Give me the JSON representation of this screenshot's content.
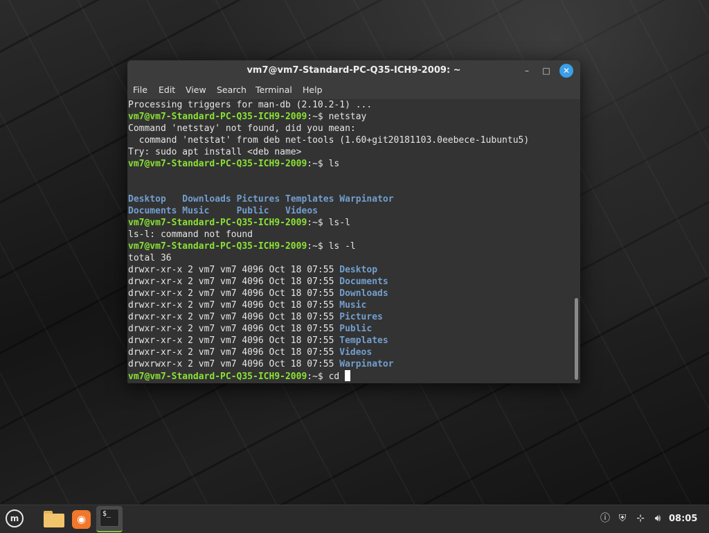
{
  "window": {
    "title": "vm7@vm7-Standard-PC-Q35-ICH9-2009: ~",
    "buttons": {
      "minimize": "–",
      "maximize": "□",
      "close": "✕"
    }
  },
  "menu": [
    "File",
    "Edit",
    "View",
    "Search",
    "Terminal",
    "Help"
  ],
  "terminal": {
    "prompt": "vm7@vm7-Standard-PC-Q35-ICH9-2009",
    "prompt_suffix": ":~$ ",
    "lines": [
      {
        "type": "output",
        "text": "Processing triggers for man-db (2.10.2-1) ..."
      },
      {
        "type": "prompt",
        "cmd": "netstay"
      },
      {
        "type": "output",
        "text": "Command 'netstay' not found, did you mean:"
      },
      {
        "type": "output",
        "text": "  command 'netstat' from deb net-tools (1.60+git20181103.0eebece-1ubuntu5)"
      },
      {
        "type": "output",
        "text": "Try: sudo apt install <deb name>"
      },
      {
        "type": "prompt",
        "cmd": "ls"
      },
      {
        "type": "output",
        "text": ""
      },
      {
        "type": "output",
        "text": ""
      },
      {
        "type": "ls",
        "items": [
          "Desktop   ",
          "Downloads ",
          "Pictures ",
          "Templates ",
          "Warpinator"
        ]
      },
      {
        "type": "ls",
        "items": [
          "Documents ",
          "Music     ",
          "Public   ",
          "Videos"
        ]
      },
      {
        "type": "prompt",
        "cmd": "ls-l"
      },
      {
        "type": "output",
        "text": "ls-l: command not found"
      },
      {
        "type": "prompt",
        "cmd": "ls -l"
      },
      {
        "type": "output",
        "text": "total 36"
      },
      {
        "type": "ll",
        "perm": "drwxr-xr-x 2 vm7 vm7 4096 Oct 18 07:55 ",
        "name": "Desktop"
      },
      {
        "type": "ll",
        "perm": "drwxr-xr-x 2 vm7 vm7 4096 Oct 18 07:55 ",
        "name": "Documents"
      },
      {
        "type": "ll",
        "perm": "drwxr-xr-x 2 vm7 vm7 4096 Oct 18 07:55 ",
        "name": "Downloads"
      },
      {
        "type": "ll",
        "perm": "drwxr-xr-x 2 vm7 vm7 4096 Oct 18 07:55 ",
        "name": "Music"
      },
      {
        "type": "ll",
        "perm": "drwxr-xr-x 2 vm7 vm7 4096 Oct 18 07:55 ",
        "name": "Pictures"
      },
      {
        "type": "ll",
        "perm": "drwxr-xr-x 2 vm7 vm7 4096 Oct 18 07:55 ",
        "name": "Public"
      },
      {
        "type": "ll",
        "perm": "drwxr-xr-x 2 vm7 vm7 4096 Oct 18 07:55 ",
        "name": "Templates"
      },
      {
        "type": "ll",
        "perm": "drwxr-xr-x 2 vm7 vm7 4096 Oct 18 07:55 ",
        "name": "Videos"
      },
      {
        "type": "ll",
        "perm": "drwxrwxr-x 2 vm7 vm7 4096 Oct 18 07:55 ",
        "name": "Warpinator"
      },
      {
        "type": "prompt",
        "cmd": "cd ",
        "cursor": true
      }
    ],
    "colors": {
      "prompt": "#8ae234",
      "directory": "#729fcf",
      "text": "#e6e6e6",
      "background": "#333333"
    }
  },
  "taskbar": {
    "launchers": [
      {
        "name": "menu-icon",
        "label": "m"
      },
      {
        "name": "folder-icon"
      },
      {
        "name": "firefox-icon",
        "label": "◉"
      },
      {
        "name": "terminal-icon",
        "label": "$_"
      }
    ],
    "tray": [
      {
        "name": "notification-icon",
        "glyph": "ⓘ"
      },
      {
        "name": "update-shield-icon",
        "glyph": "⛨"
      },
      {
        "name": "network-icon",
        "glyph": "⊹"
      },
      {
        "name": "volume-icon",
        "glyph": "🔊︎"
      }
    ],
    "clock": "08:05"
  }
}
